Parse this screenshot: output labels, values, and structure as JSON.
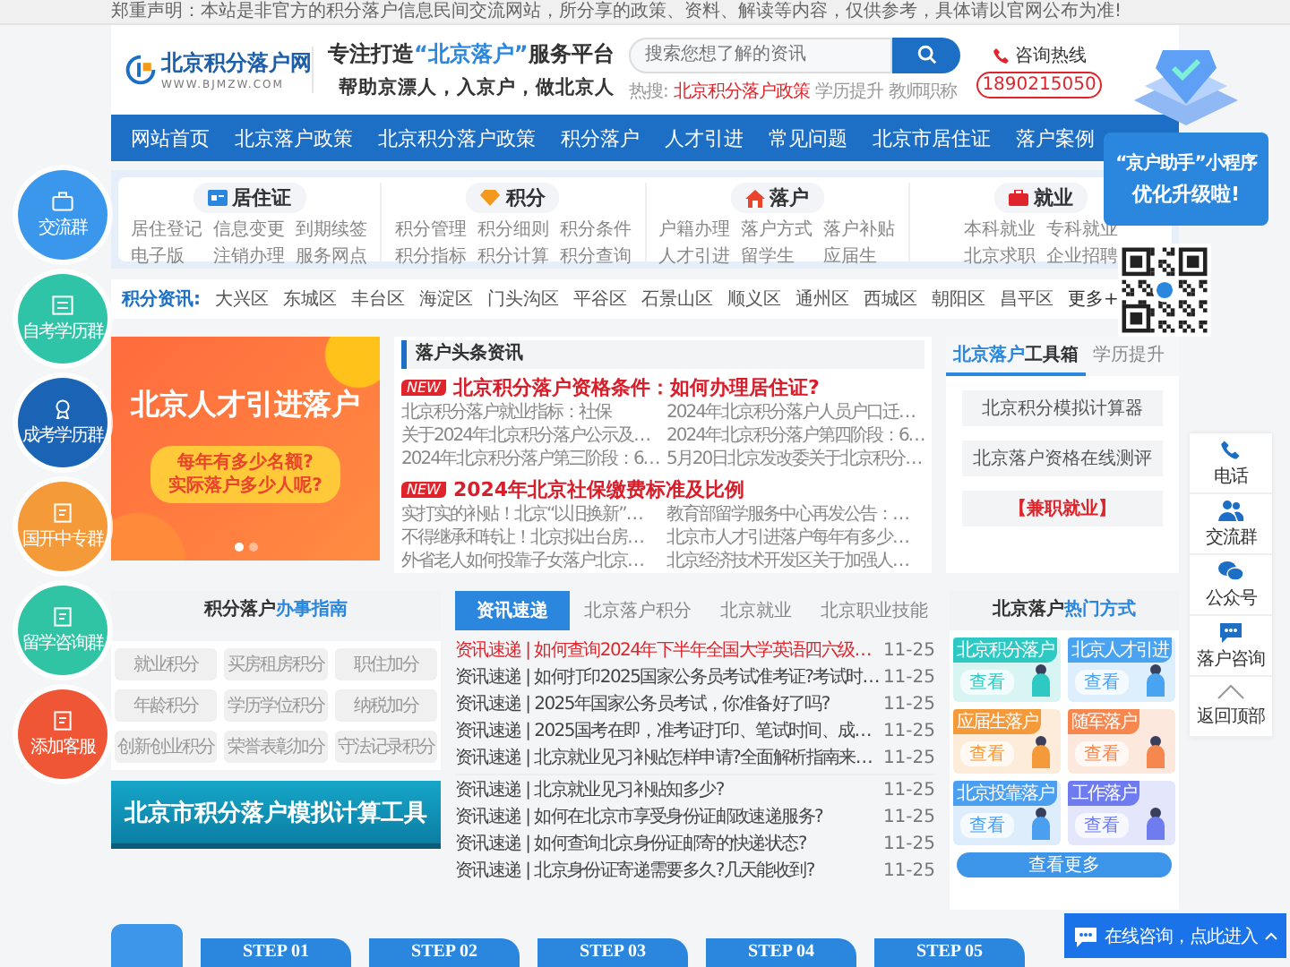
{
  "notice": "郑重声明：本站是非官方的积分落户信息民间交流网站，所分享的政策、资料、解读等内容，仅供参考，具体请以官网公布为准!",
  "header": {
    "site_name": "北京积分落户网",
    "site_url": "WWW.BJMZW.COM",
    "slogan_before": "专注打造",
    "slogan_accent": "“北京落户”",
    "slogan_after": "服务平台",
    "tagline": "帮助京漂人，入京户，做北京人"
  },
  "search": {
    "placeholder": "搜索您想了解的资讯",
    "hot_label": "热搜:",
    "hot": [
      {
        "text": "北京积分落户政策",
        "highlight": true
      },
      {
        "text": "学历提升",
        "highlight": false
      },
      {
        "text": "教师职称",
        "highlight": false
      }
    ]
  },
  "hotline": {
    "label": "咨询热线",
    "number": "1890215050"
  },
  "nav": [
    "网站首页",
    "北京落户政策",
    "北京积分落户政策",
    "积分落户",
    "人才引进",
    "常见问题",
    "北京市居住证",
    "落户案例"
  ],
  "categories": [
    {
      "title": "居住证",
      "kind": "card",
      "links": [
        "居住登记",
        "信息变更",
        "到期续签",
        "电子版",
        "注销办理",
        "服务网点"
      ]
    },
    {
      "title": "积分",
      "kind": "gem",
      "links": [
        "积分管理",
        "积分细则",
        "积分条件",
        "积分指标",
        "积分计算",
        "积分查询"
      ]
    },
    {
      "title": "落户",
      "kind": "house",
      "links": [
        "户籍办理",
        "落户方式",
        "落户补贴",
        "人才引进",
        "留学生",
        "应届生"
      ]
    },
    {
      "title": "就业",
      "kind": "case",
      "links": [
        "本科就业",
        "专科就业",
        "北京求职",
        "企业招聘"
      ]
    }
  ],
  "districts": {
    "label": "积分资讯:",
    "items": [
      "大兴区",
      "东城区",
      "丰台区",
      "海淀区",
      "门头沟区",
      "平谷区",
      "石景山区",
      "顺义区",
      "通州区",
      "西城区",
      "朝阳区",
      "昌平区"
    ],
    "more": "更多+"
  },
  "banner": {
    "title": "北京人才引进落户",
    "bubble": [
      "每年有多少名额?",
      "实际落户多少人呢?"
    ],
    "dots": [
      {
        "selected": true
      },
      {
        "selected": false
      }
    ]
  },
  "headlines": {
    "title": "落户头条资讯",
    "groups": [
      {
        "badge": "NEW",
        "headline": "北京积分落户资格条件：如何办理居住证?",
        "items": [
          "北京积分落户就业指标：社保",
          "2024年北京积分落户人员户口迁…",
          "关于2024年北京积分落户公示及…",
          "2024年北京积分落户第四阶段：6…",
          "2024年北京积分落户第三阶段：6…",
          "5月20日北京发改委关于北京积分…"
        ]
      },
      {
        "badge": "NEW",
        "headline": "2024年北京社保缴费标准及比例",
        "items": [
          "实打实的补贴！北京“以旧换新”…",
          "教育部留学服务中心再发公告：…",
          "不得继承和转让！北京拟出台房…",
          "北京市人才引进落户每年有多少…",
          "外省老人如何投靠子女落户北京…",
          "北京经济技术开发区关于加强人…"
        ]
      }
    ]
  },
  "toolbox": {
    "tabs": [
      {
        "accent": "北京落户",
        "label": "工具箱",
        "selected": true
      },
      {
        "label": "学历提升",
        "selected": false
      }
    ],
    "buttons": [
      {
        "label": "北京积分模拟计算器",
        "highlight": false
      },
      {
        "label": "北京落户资格在线测评",
        "highlight": false
      },
      {
        "label": "【兼职就业】",
        "highlight": true
      }
    ]
  },
  "guide": {
    "title": "积分落户",
    "title_accent": "办事指南",
    "items": [
      "就业积分",
      "买房租房积分",
      "职住加分",
      "年龄积分",
      "学历学位积分",
      "纳税加分",
      "创新创业积分",
      "荣誉表彰加分",
      "守法记录积分"
    ],
    "banner": "北京市积分落户模拟计算工具"
  },
  "news_tabs": [
    {
      "label": "资讯速递",
      "selected": true
    },
    {
      "label": "北京落户积分",
      "selected": false
    },
    {
      "label": "北京就业",
      "selected": false
    },
    {
      "label": "北京职业技能",
      "selected": false
    }
  ],
  "news_groups": [
    [
      {
        "text": "资讯速递 | 如何查询2024年下半年全国大学英语四六级…",
        "date": "11-25",
        "highlight": true
      },
      {
        "text": "资讯速递 | 如何打印2025国家公务员考试准考证?考试时…",
        "date": "11-25",
        "highlight": false
      },
      {
        "text": "资讯速递 | 2025年国家公务员考试，你准备好了吗?",
        "date": "11-25",
        "highlight": false
      },
      {
        "text": "资讯速递 | 2025国考在即，准考证打印、笔试时间、成…",
        "date": "11-25",
        "highlight": false
      },
      {
        "text": "资讯速递 | 北京就业见习补贴怎样申请?全面解析指南来…",
        "date": "11-25",
        "highlight": false
      }
    ],
    [
      {
        "text": "资讯速递 | 北京就业见习补贴知多少?",
        "date": "11-25",
        "highlight": false
      },
      {
        "text": "资讯速递 | 如何在北京市享受身份证邮政速递服务?",
        "date": "11-25",
        "highlight": false
      },
      {
        "text": "资讯速递 | 如何查询北京身份证邮寄的快递状态?",
        "date": "11-25",
        "highlight": false
      },
      {
        "text": "资讯速递 | 北京身份证寄递需要多久?几天能收到?",
        "date": "11-25",
        "highlight": false
      }
    ]
  ],
  "hot_ways": {
    "title": "北京落户",
    "title_accent": "热门方式",
    "cards": [
      {
        "label": "北京积分落户",
        "button": "查看",
        "color": "#2ec9c2"
      },
      {
        "label": "北京人才引进",
        "button": "查看",
        "color": "#4aa3f0"
      },
      {
        "label": "应届生落户",
        "button": "查看",
        "color": "#f59a3b"
      },
      {
        "label": "随军落户",
        "button": "查看",
        "color": "#f5874f"
      },
      {
        "label": "北京投靠落户",
        "button": "查看",
        "color": "#4b9ff0"
      },
      {
        "label": "工作落户",
        "button": "查看",
        "color": "#6f7cf0"
      }
    ],
    "more": "查看更多"
  },
  "steps": [
    "STEP 01",
    "STEP 02",
    "STEP 03",
    "STEP 04",
    "STEP 05"
  ],
  "side_groups": [
    {
      "label": "交流群",
      "color": "#3b97ec",
      "kind": "case"
    },
    {
      "label": "自考学历群",
      "color": "#2fc4a8",
      "kind": "card"
    },
    {
      "label": "成考学历群",
      "color": "#1b63b4",
      "kind": "medal"
    },
    {
      "label": "国开中专群",
      "color": "#f59a38",
      "kind": "note"
    },
    {
      "label": "留学咨询群",
      "color": "#30c4a4",
      "kind": "note"
    },
    {
      "label": "添加客服",
      "color": "#ee5636",
      "kind": "note"
    }
  ],
  "promo": {
    "title": "“京户助手”小程序",
    "subtitle": "优化升级啦!"
  },
  "float_tools": [
    {
      "label": "电话",
      "kind": "phone"
    },
    {
      "label": "交流群",
      "kind": "people"
    },
    {
      "label": "公众号",
      "kind": "wechat"
    },
    {
      "label": "落户咨询",
      "kind": "chat"
    },
    {
      "label": "返回顶部",
      "kind": "top"
    }
  ],
  "chat": {
    "label": "在线咨询，点此进入"
  }
}
